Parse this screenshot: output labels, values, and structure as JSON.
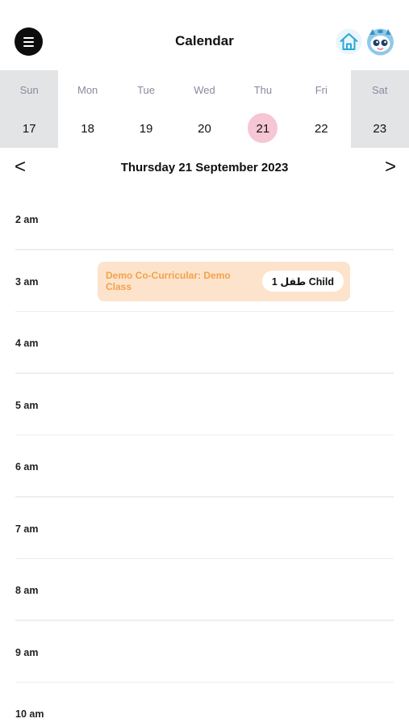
{
  "header": {
    "title": "Calendar",
    "menu_icon": "menu-icon",
    "home_icon": "home-icon",
    "avatar_icon": "robot-avatar-icon"
  },
  "week": {
    "days": [
      {
        "name": "Sun",
        "num": "17",
        "weekend": true,
        "selected": false
      },
      {
        "name": "Mon",
        "num": "18",
        "weekend": false,
        "selected": false
      },
      {
        "name": "Tue",
        "num": "19",
        "weekend": false,
        "selected": false
      },
      {
        "name": "Wed",
        "num": "20",
        "weekend": false,
        "selected": false
      },
      {
        "name": "Thu",
        "num": "21",
        "weekend": false,
        "selected": true
      },
      {
        "name": "Fri",
        "num": "22",
        "weekend": false,
        "selected": false
      },
      {
        "name": "Sat",
        "num": "23",
        "weekend": true,
        "selected": false
      }
    ]
  },
  "date_nav": {
    "prev": "<",
    "next": ">",
    "date_label": "Thursday 21 September 2023"
  },
  "timeline": {
    "slots": [
      "2 am",
      "3 am",
      "4 am",
      "5 am",
      "6 am",
      "7 am",
      "8 am",
      "9 am",
      "10 am"
    ]
  },
  "event": {
    "title": "Demo Co-Curricular: Demo Class",
    "chip": "1 طفل Child"
  },
  "colors": {
    "accent_selected": "#f6c6d5",
    "event_bg": "#fde3cc",
    "event_text": "#f2a24a",
    "weekend_bg": "#e3e4e6"
  }
}
